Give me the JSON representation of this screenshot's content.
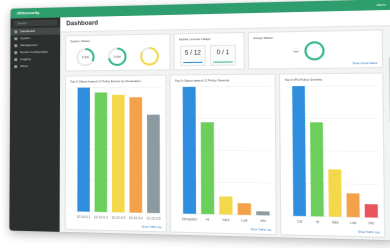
{
  "app": {
    "brand": "JNXsecurity"
  },
  "sidebar": {
    "search_placeholder": "Search",
    "items": [
      {
        "label": "Dashboard",
        "icon": "dashboard-icon"
      },
      {
        "label": "System",
        "icon": "system-icon"
      },
      {
        "label": "Management",
        "icon": "management-icon"
      },
      {
        "label": "Device Configuration",
        "icon": "device-icon"
      },
      {
        "label": "Logging",
        "icon": "logging-icon"
      },
      {
        "label": "About",
        "icon": "info-icon"
      }
    ]
  },
  "header": {
    "user_menu": "admin"
  },
  "page": {
    "title": "Dashboard"
  },
  "cards": {
    "system_status": {
      "title": "System Status",
      "gauges": [
        "5.2%",
        "3.0%",
        ""
      ]
    },
    "mobile_license": {
      "title": "Mobile License Usage",
      "values": [
        "5 / 12",
        "0 / 1"
      ]
    },
    "group_status": {
      "title": "Group Status",
      "link": "Show Group Status"
    },
    "chart1": {
      "title": "Top 5 Object-based L3 Policy Events by Destination",
      "link": "Show Traffic Log"
    },
    "chart2": {
      "title": "Top 5 Object-based L3 Policy Severity",
      "link": "Show Traffic Log"
    },
    "chart3": {
      "title": "Top 5 IPS Policy Severity",
      "link": "Show Traffic Log"
    }
  },
  "colors": {
    "accent": "#2f9e6e",
    "sidebar": "#2b2f2e",
    "link": "#2a76c6"
  },
  "chart_data": [
    {
      "type": "bar",
      "categories": [
        "10.10.0.1",
        "10.10.0.2",
        "10.10.0.3",
        "10.10.0.4",
        "10.10.0.5"
      ],
      "values": [
        100,
        96,
        94,
        92,
        78
      ],
      "ylim": [
        0,
        100
      ],
      "colors": [
        "#2f8fde",
        "#6dcf5b",
        "#f2d84a",
        "#f4a24a",
        "#8e9aa2"
      ]
    },
    {
      "type": "bar",
      "categories": [
        "Disruption",
        "Hi",
        "Med",
        "Low",
        "Info"
      ],
      "values": [
        100,
        72,
        14,
        9,
        3
      ],
      "ylim": [
        0,
        100
      ],
      "colors": [
        "#2f8fde",
        "#6dcf5b",
        "#f2d84a",
        "#f4a24a",
        "#8e9aa2"
      ]
    },
    {
      "type": "bar",
      "categories": [
        "Crit",
        "Hi",
        "Med",
        "Low",
        "Info"
      ],
      "values": [
        100,
        72,
        36,
        18,
        10
      ],
      "ylim": [
        0,
        100
      ],
      "colors": [
        "#2f8fde",
        "#6dcf5b",
        "#f2d84a",
        "#f4a24a",
        "#e8555a"
      ]
    }
  ]
}
